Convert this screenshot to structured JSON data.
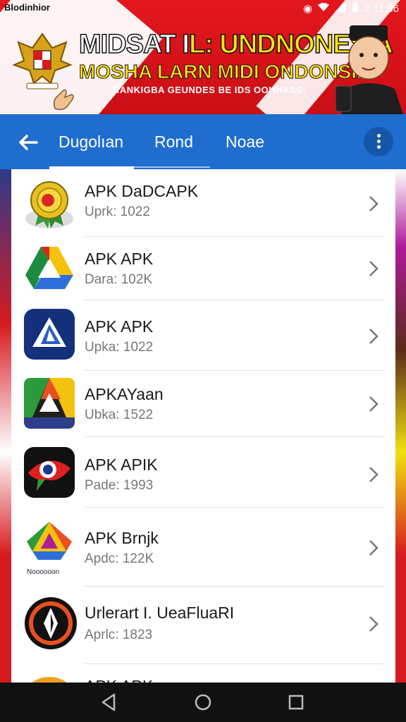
{
  "status_bar": {
    "left_text": "Blodinhior",
    "right_text": "2 11:86"
  },
  "banner": {
    "title_part1": "MIDSAT I",
    "title_part2": "L: UNDNONESIA",
    "title_line2": "MOSHA LARN MIDI ONDONSIA",
    "subtitle": "RANKIGBA GEUNDES BE IDS OOHHASS:",
    "emblem_icon": "garuda-emblem-icon"
  },
  "app_bar": {
    "tabs": [
      {
        "label": "Dugolıan"
      },
      {
        "label": "Rond"
      },
      {
        "label": "Noae"
      }
    ],
    "back_icon": "back-arrow-icon",
    "more_icon": "more-vert-icon",
    "color": "#1f6ecf"
  },
  "apps": [
    {
      "name": "APK DaDCAPK",
      "meta": "Uprk: 1022",
      "icon": "gold-medal-icon"
    },
    {
      "name": "APK APK",
      "meta": "Dara: 102K",
      "icon": "google-drive-icon"
    },
    {
      "name": "APK APK",
      "meta": "Upka: 1022",
      "icon": "drive-blue-icon"
    },
    {
      "name": "APKAYaan",
      "meta": "Ubka: 1522",
      "icon": "drive-color-icon"
    },
    {
      "name": "APK APIK",
      "meta": "Pade: 1993",
      "icon": "eye-chat-icon"
    },
    {
      "name": "APK  Brnjk",
      "meta": "Apdc: 122K",
      "icon": "drive-store-icon",
      "icon_caption": "Noooooon"
    },
    {
      "name": "Urlerart I. UeaFluaRI",
      "meta": "Aprlc: 1823",
      "icon": "orange-ring-icon"
    },
    {
      "name": "APK APK",
      "meta": "",
      "icon": "orange-partial-icon"
    }
  ]
}
